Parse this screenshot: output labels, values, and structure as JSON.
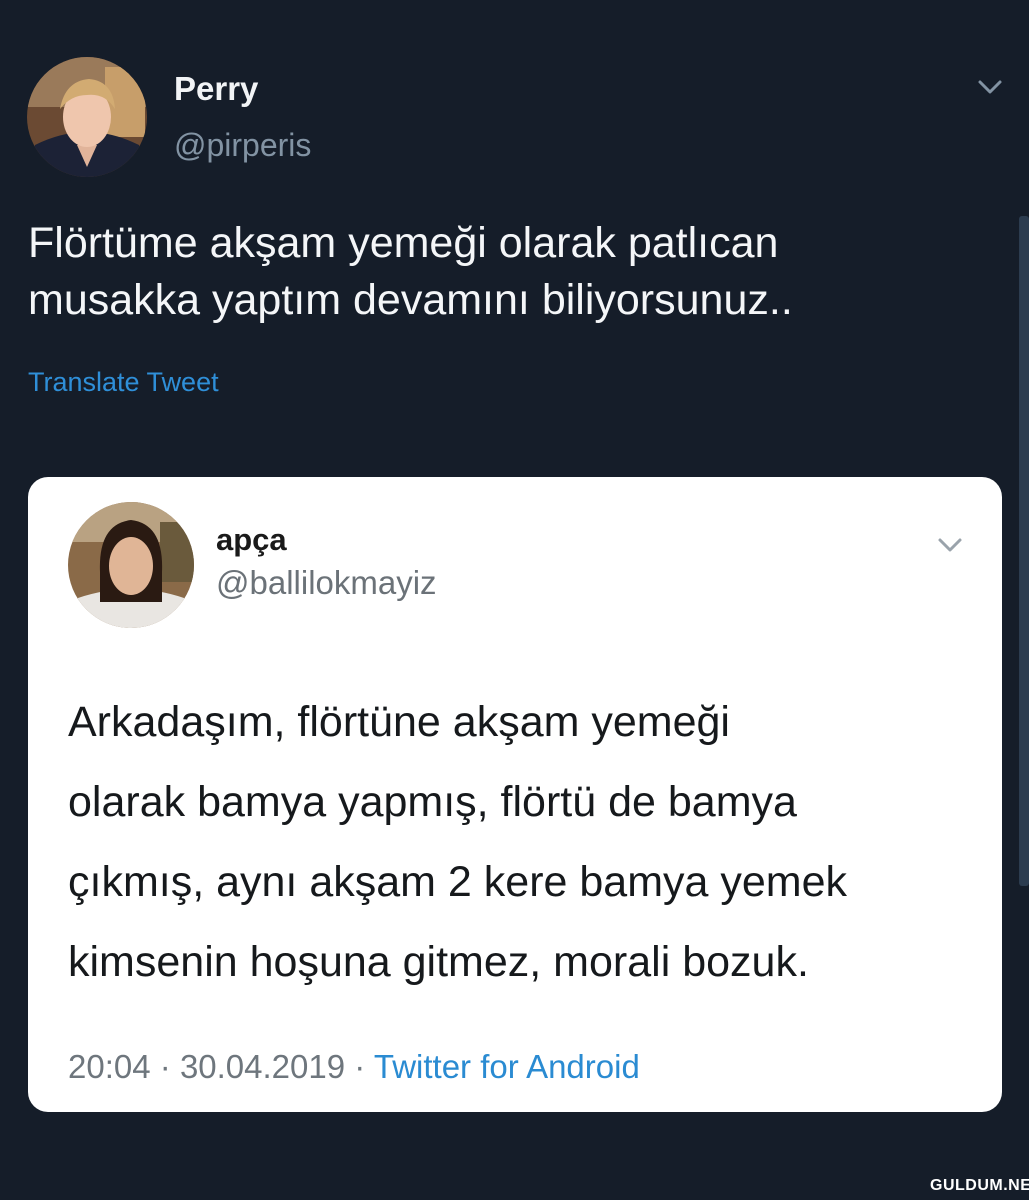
{
  "outer_tweet": {
    "author_name": "Perry",
    "author_handle": "@pirperis",
    "text": "Flörtüme akşam yemeği olarak patlıcan\nmusakka yaptım devamını biliyorsunuz..",
    "translate_label": "Translate Tweet"
  },
  "quoted_tweet": {
    "author_name": "apça",
    "author_handle": "@ballilokmayiz",
    "text": "Arkadaşım, flörtüne akşam yemeği\nolarak bamya yapmış, flörtü de bamya\nçıkmış, aynı akşam 2 kere bamya yemek\nkimsenin hoşuna gitmez, morali bozuk.",
    "time": "20:04",
    "date": "30.04.2019",
    "separator": "·",
    "source": "Twitter for Android"
  },
  "watermark": "GULDUM.NET",
  "colors": {
    "background": "#151d29",
    "link": "#2f8fd8",
    "card": "#ffffff"
  },
  "icons": [
    "chevron-down-icon"
  ]
}
